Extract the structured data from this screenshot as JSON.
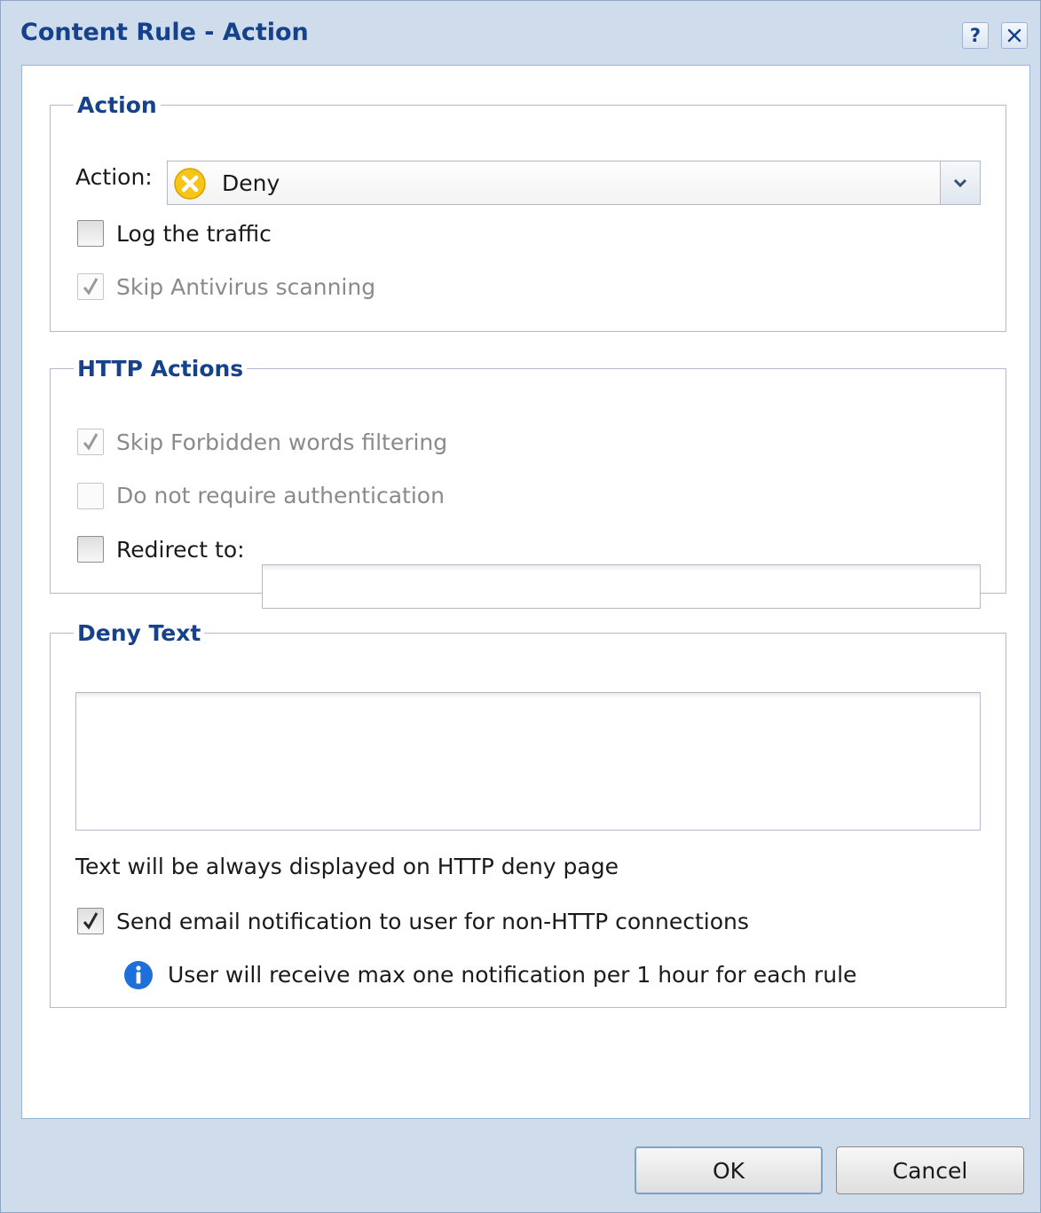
{
  "window": {
    "title": "Content Rule - Action",
    "help_label": "?"
  },
  "action_group": {
    "legend": "Action",
    "action_label": "Action:",
    "action_value": "Deny",
    "log_traffic": {
      "label": "Log the traffic",
      "checked": false
    },
    "skip_antivirus": {
      "label": "Skip Antivirus scanning",
      "checked": true,
      "disabled": true
    }
  },
  "http_group": {
    "legend": "HTTP Actions",
    "skip_forbidden": {
      "label": "Skip Forbidden words filtering",
      "checked": true,
      "disabled": true
    },
    "no_auth": {
      "label": "Do not require authentication",
      "checked": false,
      "disabled": true
    },
    "redirect": {
      "label": "Redirect to:",
      "checked": false,
      "value": ""
    }
  },
  "deny_group": {
    "legend": "Deny Text",
    "text_value": "",
    "hint": "Text will be always displayed on HTTP deny page",
    "email_notify": {
      "label": "Send email notification to user for non-HTTP connections",
      "checked": true
    },
    "info": "User will receive max one notification per 1 hour for each rule"
  },
  "buttons": {
    "ok": "OK",
    "cancel": "Cancel"
  },
  "colors": {
    "title": "#15428b",
    "deny_icon": "#f5c518",
    "info_icon": "#1e6fd9",
    "disabled_text": "#8a8a8a"
  }
}
